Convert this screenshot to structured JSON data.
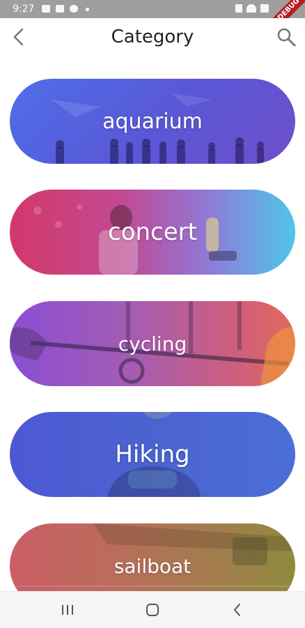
{
  "status_bar": {
    "time": "9:27",
    "debug_label": "DEBUG"
  },
  "app_bar": {
    "title": "Category",
    "back_icon": "back-arrow-icon",
    "search_icon": "search-icon"
  },
  "categories": [
    {
      "label": "aquarium",
      "colors": [
        "#4f6ee8",
        "#6f4fc8"
      ]
    },
    {
      "label": "concert",
      "colors": [
        "#d2386a",
        "#4fc6ea"
      ]
    },
    {
      "label": "cycling",
      "colors": [
        "#8a4fd4",
        "#e06a5a"
      ]
    },
    {
      "label": "Hiking",
      "colors": [
        "#4c58d4",
        "#4c6ed7"
      ]
    },
    {
      "label": "sailboat",
      "colors": [
        "#cb5e66",
        "#8f8a3c"
      ]
    }
  ],
  "nav_bar": {
    "recents_icon": "recents-icon",
    "home_icon": "home-icon",
    "back_icon": "nav-back-icon"
  }
}
